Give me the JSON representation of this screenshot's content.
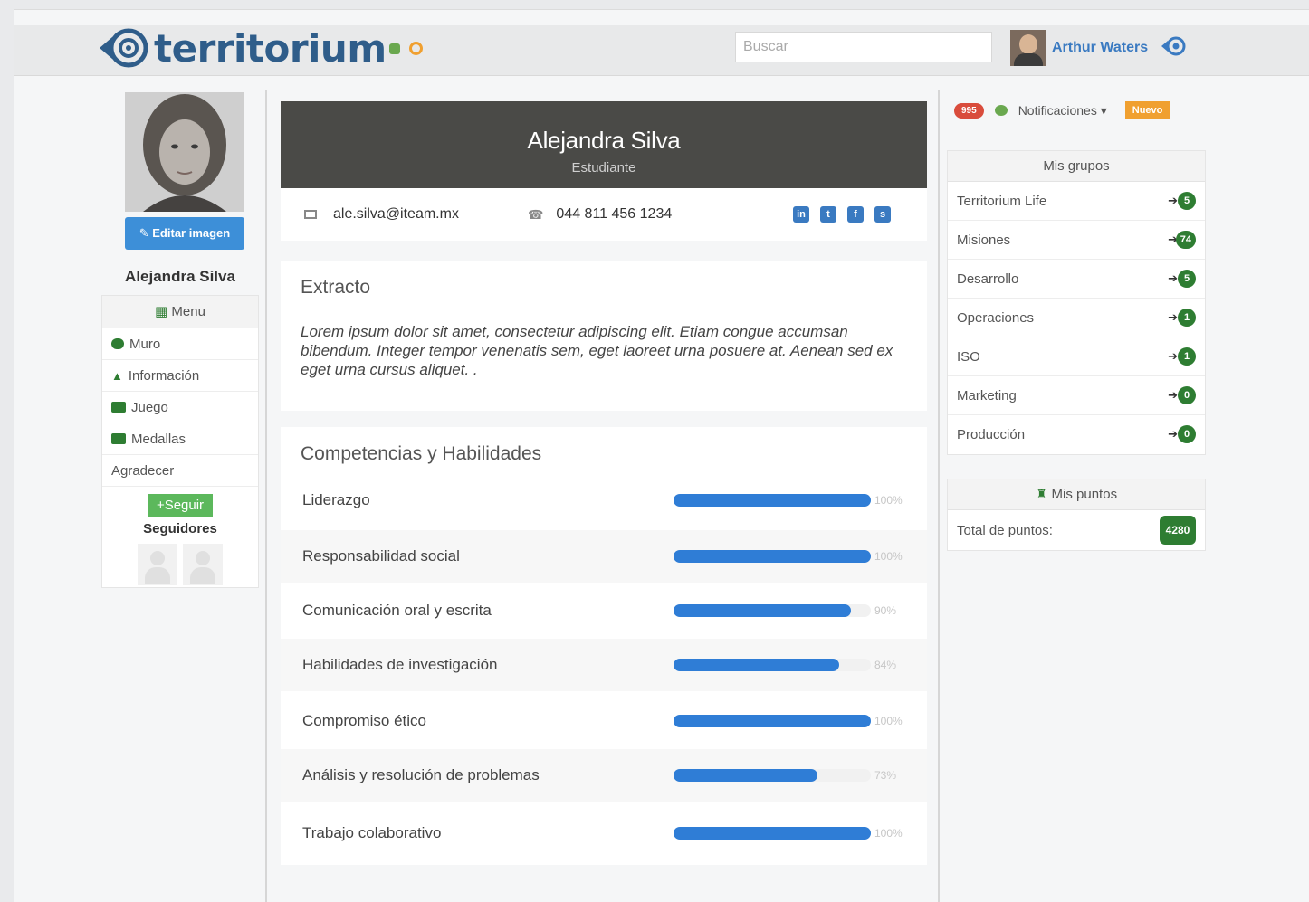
{
  "header": {
    "logo_text": "territorium",
    "search_placeholder": "Buscar",
    "user_name": "Arthur Waters"
  },
  "sidebar": {
    "edit_image_label": "Editar imagen",
    "profile_name": "Alejandra Silva",
    "menu_title": "Menu",
    "items": [
      {
        "label": "Muro"
      },
      {
        "label": "Información"
      },
      {
        "label": "Juego"
      },
      {
        "label": "Medallas"
      },
      {
        "label": "Agradecer"
      }
    ],
    "follow_label": "+Seguir",
    "followers_label": "Seguidores"
  },
  "profile": {
    "name": "Alejandra Silva",
    "role": "Estudiante",
    "email": "ale.silva@iteam.mx",
    "phone": "044 811 456 1234"
  },
  "extract": {
    "title": "Extracto",
    "text": "Lorem ipsum dolor sit amet, consectetur adipiscing elit. Etiam congue accumsan bibendum. Integer tempor venenatis sem, eget laoreet urna posuere at. Aenean sed ex eget urna cursus aliquet. ."
  },
  "skills": {
    "title": "Competencias y Habilidades",
    "items": [
      {
        "label": "Liderazgo",
        "value": 100,
        "pct": "100%"
      },
      {
        "label": "Responsabilidad social",
        "value": 100,
        "pct": "100%"
      },
      {
        "label": "Comunicación oral y escrita",
        "value": 90,
        "pct": "90%"
      },
      {
        "label": "Habilidades de investigación",
        "value": 84,
        "pct": "84%"
      },
      {
        "label": "Compromiso ético",
        "value": 100,
        "pct": "100%"
      },
      {
        "label": "Análisis y resolución de problemas",
        "value": 73,
        "pct": "73%"
      },
      {
        "label": "Trabajo colaborativo",
        "value": 100,
        "pct": "100%"
      }
    ]
  },
  "right": {
    "notif_count": "995",
    "notif_label": "Notificaciones ▾",
    "new_label": "Nuevo",
    "groups_title": "Mis grupos",
    "groups": [
      {
        "name": "Territorium Life",
        "count": "5"
      },
      {
        "name": "Misiones",
        "count": "74"
      },
      {
        "name": "Desarrollo",
        "count": "5"
      },
      {
        "name": "Operaciones",
        "count": "1"
      },
      {
        "name": "ISO",
        "count": "1"
      },
      {
        "name": "Marketing",
        "count": "0"
      },
      {
        "name": "Producción",
        "count": "0"
      }
    ],
    "points_title": "Mis puntos",
    "points_label": "Total de puntos:",
    "points_value": "4280"
  },
  "colors": {
    "brand": "#2f5d8a",
    "accent": "#2f7dd6",
    "hero": "#4a4a47",
    "badge_green": "#2e7d32"
  }
}
